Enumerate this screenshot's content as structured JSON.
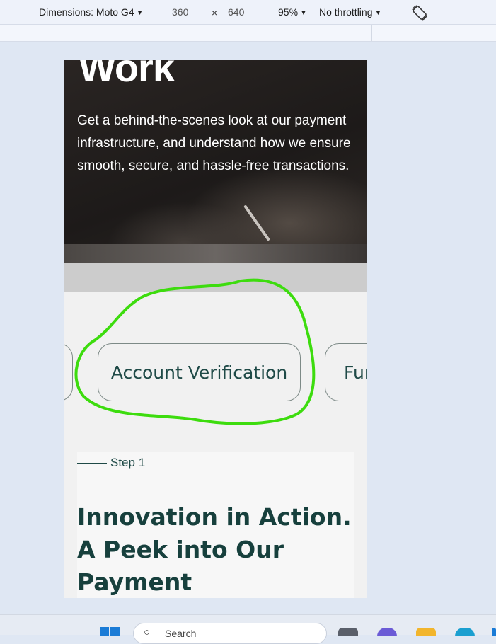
{
  "devtools": {
    "device_label": "Dimensions: Moto G4",
    "width": "360",
    "times": "×",
    "height": "640",
    "zoom": "95%",
    "throttling": "No throttling",
    "rotate_icon": "rotate-icon"
  },
  "page": {
    "hero": {
      "title": "Work",
      "description": "Get a behind-the-scenes look at our payment infrastructure, and understand how we ensure smooth, secure, and hassle-free transactions."
    },
    "tabs": [
      {
        "label": ""
      },
      {
        "label": "Account Verification"
      },
      {
        "label": "Fur"
      }
    ],
    "step": {
      "label": "Step 1",
      "heading": "Innovation in Action. A Peek into Our Payment"
    }
  },
  "taskbar": {
    "search_placeholder": "Search",
    "colors": {
      "accent": "#1a7bd6",
      "annotation": "#3ddc0e",
      "brand_green": "#17403d"
    }
  }
}
